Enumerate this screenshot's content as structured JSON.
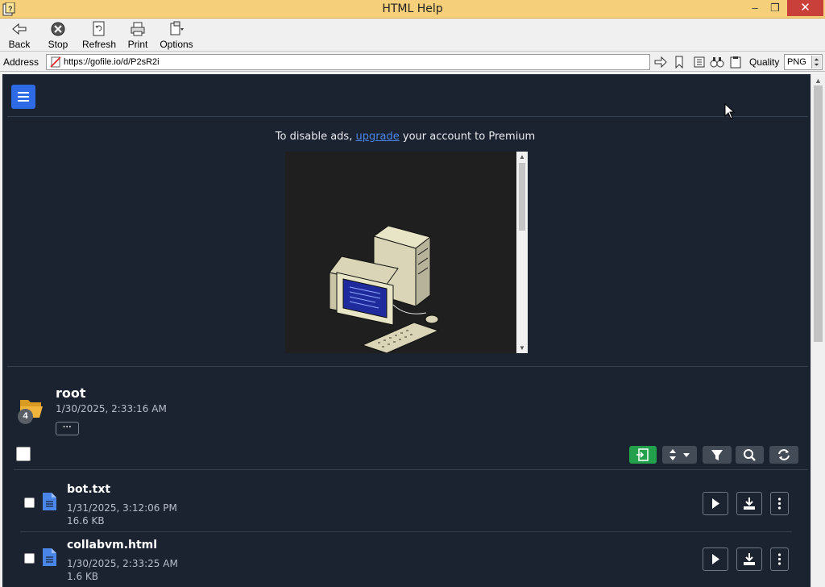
{
  "window": {
    "title": "HTML Help",
    "controls": {
      "minimize": "–",
      "maximize": "❐",
      "close": "✕"
    }
  },
  "toolbar": {
    "back": "Back",
    "stop": "Stop",
    "refresh": "Refresh",
    "print": "Print",
    "options": "Options"
  },
  "address": {
    "label": "Address",
    "url": "https://gofile.io/d/P2sR2i",
    "quality_label": "Quality",
    "quality_value": "PNG"
  },
  "page": {
    "ad_notice_before": "To disable ads, ",
    "ad_notice_link": "upgrade",
    "ad_notice_after": " your account to Premium",
    "folder": {
      "name": "root",
      "date": "1/30/2025, 2:33:16 AM",
      "count": "4",
      "more_label": "···"
    },
    "files": [
      {
        "name": "bot.txt",
        "date": "1/31/2025, 3:12:06 PM",
        "size": "16.6 KB"
      },
      {
        "name": "collabvm.html",
        "date": "1/30/2025, 2:33:25 AM",
        "size": "1.6 KB"
      }
    ]
  },
  "icons": {
    "menu": "hamburger-icon",
    "folder": "folder-open-icon",
    "file": "file-icon",
    "actions": [
      "import-icon",
      "sort-icon",
      "filter-icon",
      "search-icon",
      "refresh-icon"
    ],
    "row_actions": [
      "play-icon",
      "download-icon",
      "kebab-icon"
    ]
  },
  "colors": {
    "page_bg": "#1b2331",
    "accent": "#2d6ae6",
    "link": "#4a86e8",
    "import_green": "#22a04b",
    "titlebar": "#f5cf7a",
    "file_icon": "#4a86e8",
    "folder_icon": "#f0b43c"
  }
}
